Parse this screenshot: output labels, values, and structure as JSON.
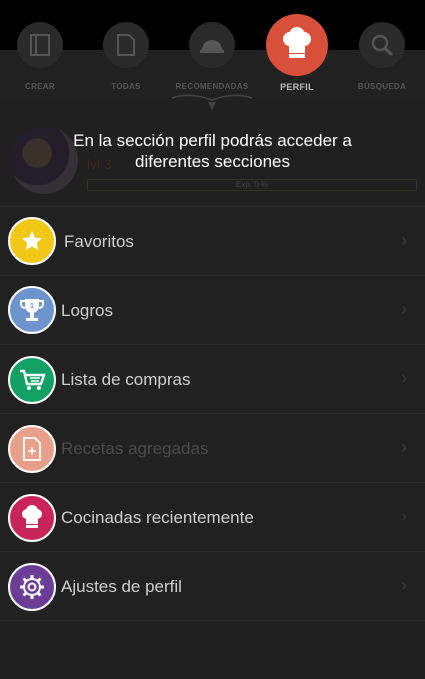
{
  "tabs": [
    {
      "label": "CREAR",
      "icon": "book-icon"
    },
    {
      "label": "TODAS",
      "icon": "document-icon"
    },
    {
      "label": "RECOMENDADAS",
      "icon": "cloche-icon"
    },
    {
      "label": "PERFIL",
      "icon": "chef-hat-icon"
    },
    {
      "label": "BÚSQUEDA",
      "icon": "search-icon"
    }
  ],
  "profile": {
    "level": "lvl 3",
    "xp_text": "Exp. 0 %",
    "xp_progress": 0
  },
  "tooltip": {
    "text": "En la sección perfil podrás acceder a diferentes secciones"
  },
  "menu": [
    {
      "label": "Favoritos",
      "icon": "star-icon",
      "color": "#f2c818"
    },
    {
      "label": "Logros",
      "icon": "trophy-icon",
      "color": "#6d94cc"
    },
    {
      "label": "Lista de compras",
      "icon": "cart-icon",
      "color": "#12a064"
    },
    {
      "label": "Recetas agregadas",
      "icon": "recipe-add-icon",
      "color": "#e9a08a"
    },
    {
      "label": "Cocinadas recientemente",
      "icon": "chef-hat-icon",
      "color": "#c7245a"
    },
    {
      "label": "Ajustes de perfil",
      "icon": "gear-icon",
      "color": "#6c3d96"
    }
  ],
  "chevron": "›"
}
